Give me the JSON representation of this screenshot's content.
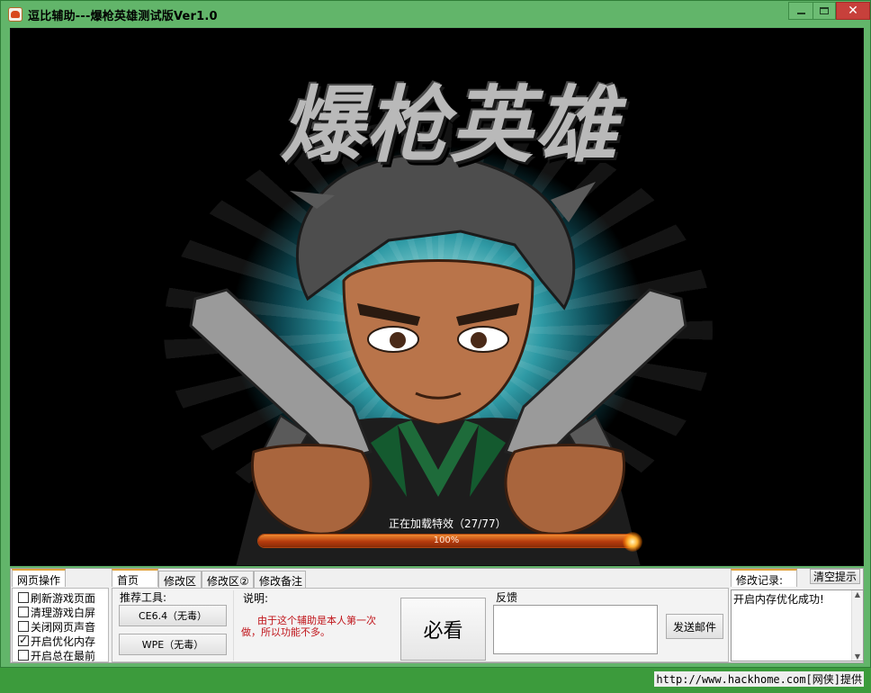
{
  "window": {
    "title": "逗比辅助---爆枪英雄测试版Ver1.0",
    "close_glyph": "✕"
  },
  "game": {
    "logo": "爆枪英雄",
    "loading_text": "正在加载特效（27/77）",
    "progress_percent": 100,
    "progress_label": "100%"
  },
  "left_tab": {
    "label": "网页操作",
    "options": [
      {
        "label": "刷新游戏页面",
        "checked": false
      },
      {
        "label": "清理游戏白屏",
        "checked": false
      },
      {
        "label": "关闭网页声音",
        "checked": false
      },
      {
        "label": "开启优化内存",
        "checked": true
      },
      {
        "label": "开启总在最前",
        "checked": false
      }
    ]
  },
  "main_tabs": [
    {
      "label": "首页",
      "active": true
    },
    {
      "label": "修改区",
      "active": false
    },
    {
      "label": "修改区②",
      "active": false
    },
    {
      "label": "修改备注",
      "active": false
    }
  ],
  "tools": {
    "heading": "推荐工具:",
    "ce_button": "CE6.4（无毒）",
    "wpe_button": "WPE（无毒）"
  },
  "notes": {
    "heading": "说明:",
    "text_line1": "由于这个辅助是本人第一次",
    "text_line2": "做，所以功能不多。"
  },
  "must_see_button": "必看",
  "feedback": {
    "heading": "反馈",
    "input_value": "",
    "send_button": "发送邮件"
  },
  "log": {
    "tab_label": "修改记录:",
    "clear_button": "清空提示",
    "entry": "开启内存优化成功!",
    "scroll_up": "▲",
    "scroll_down": "▼"
  },
  "footer": {
    "link_text": "http://www.hackhome.com[网侠]提供"
  },
  "colors": {
    "titlebar": "#62b56a",
    "close_button": "#c7403b",
    "progress_fill": "#d05a1c",
    "note_text": "#c0141a"
  }
}
